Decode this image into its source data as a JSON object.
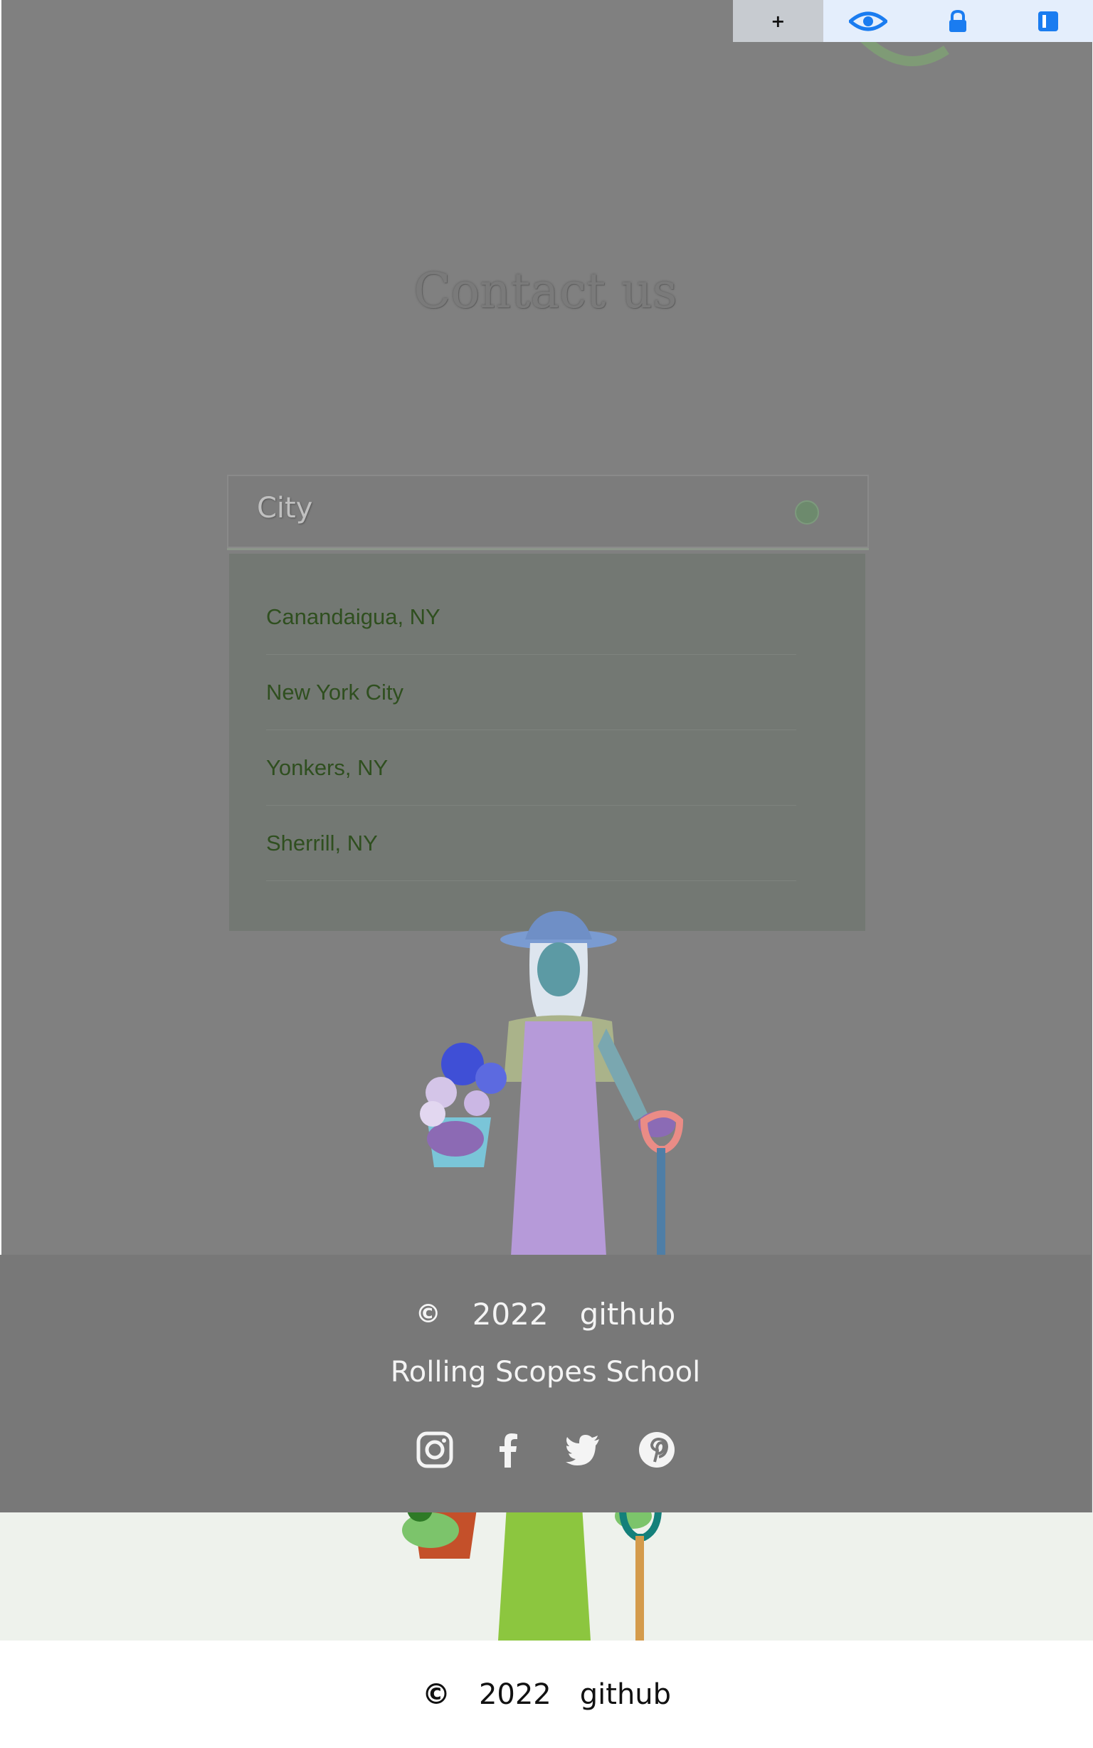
{
  "toolbar": {
    "add_label": "+",
    "icons": [
      "eye-icon",
      "lock-icon",
      "panel-icon"
    ]
  },
  "contact": {
    "title": "Contact us"
  },
  "city_select": {
    "label": "City",
    "options": [
      "Canandaigua, NY",
      "New York City",
      "Yonkers, NY",
      "Sherrill, NY"
    ]
  },
  "footer": {
    "copyright_symbol": "©",
    "year": "2022",
    "github": "github",
    "school": "Rolling Scopes School",
    "social": [
      "instagram-icon",
      "facebook-icon",
      "twitter-icon",
      "pinterest-icon"
    ]
  },
  "bottom_footer": {
    "copyright_symbol": "©",
    "year": "2022",
    "github": "github"
  },
  "colors": {
    "overlay": "#808080",
    "accent_blue": "#1a7cf0",
    "city_text": "#2f4f1f"
  }
}
